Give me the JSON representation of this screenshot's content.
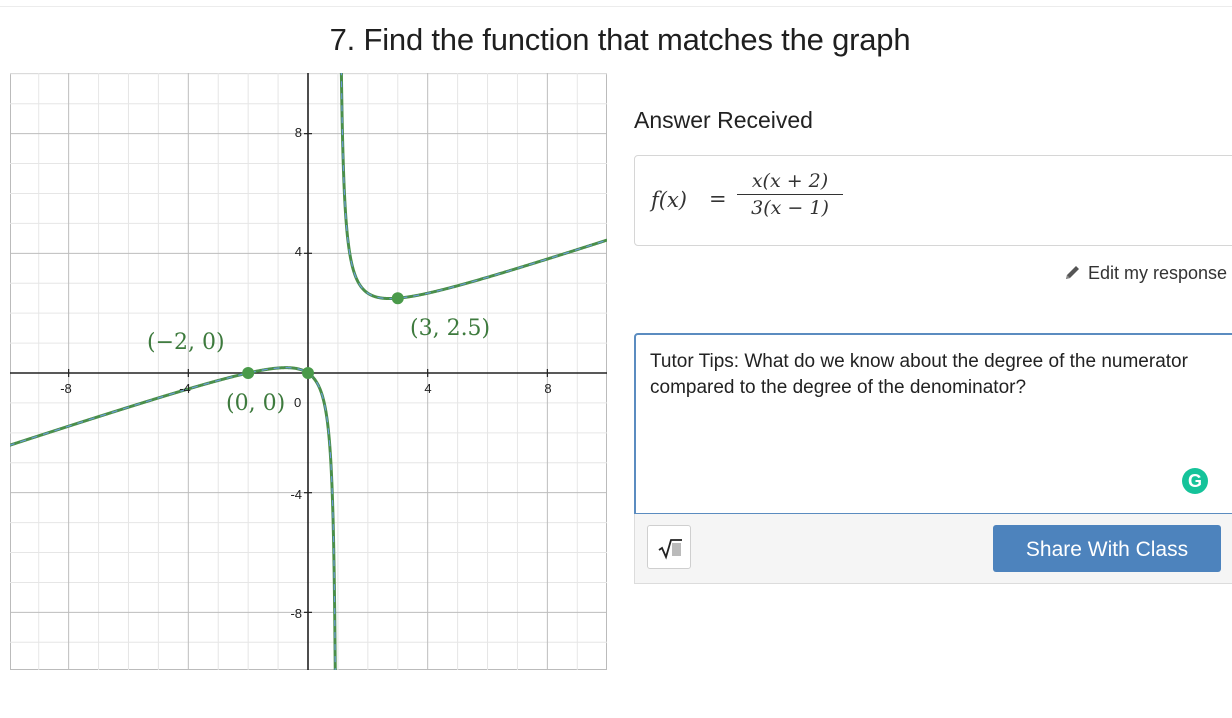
{
  "page": {
    "title": "7. Find the function that matches the graph"
  },
  "graph": {
    "x_tick_labels": [
      "-8",
      "-4",
      "4",
      "8"
    ],
    "y_tick_labels": [
      "8",
      "4",
      "-4",
      "-8"
    ],
    "origin_label": "0",
    "points": [
      {
        "label": "(−2, 0)",
        "x": -2,
        "y": 0
      },
      {
        "label": "(0, 0)",
        "x": 0,
        "y": 0
      },
      {
        "label": "(3, 2.5)",
        "x": 3,
        "y": 2.5
      }
    ],
    "colors": {
      "curve": "#4a8f4a",
      "curve_dash": "#6a9bd8",
      "point": "#4a9a4a"
    }
  },
  "answer": {
    "heading": "Answer Received",
    "lhs": "f(x)",
    "eq": "=",
    "numerator": "x(x + 2)",
    "denominator": "3(x − 1)"
  },
  "edit": {
    "label": "Edit my response",
    "icon": "pencil-icon"
  },
  "tips": {
    "text": "Tutor Tips: What do we know about the degree of the numerator compared to the degree of the denominator?",
    "grammarly_glyph": "G"
  },
  "toolbar": {
    "sqrt_icon": "square-root-icon",
    "share_label": "Share With Class"
  },
  "colors": {
    "accent": "#4d83bd",
    "tips_border": "#5b8cc0",
    "grammarly": "#15c39a"
  }
}
